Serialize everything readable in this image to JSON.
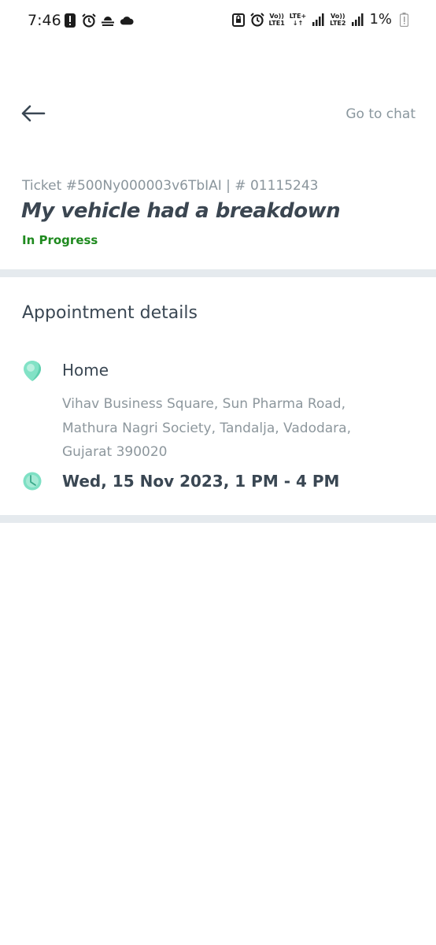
{
  "status_bar": {
    "time": "7:46",
    "left_icons": [
      "alert-icon",
      "alarm-icon",
      "haze-icon",
      "cloud-icon"
    ],
    "right_icons": [
      "sim-lock-icon",
      "alarm-icon",
      "volte-lte1-icon",
      "lte-plus-icon",
      "signal-icon",
      "volte-lte2-icon",
      "signal-icon"
    ],
    "lte1_top": "Vo))",
    "lte1_bottom": "LTE1",
    "lte_plus_top": "LTE+",
    "lte_plus_bottom": "↓↑",
    "lte2_top": "Vo))",
    "lte2_bottom": "LTE2",
    "battery": "1%"
  },
  "header": {
    "go_to_chat": "Go to chat"
  },
  "ticket": {
    "id_line": "Ticket #500Ny000003v6TbIAI | # 01115243",
    "title": "My vehicle had a breakdown",
    "status": "In Progress",
    "status_color": "#1f8a1f"
  },
  "appointment": {
    "section_title": "Appointment details",
    "location_label": "Home",
    "address": "Vihav Business Square, Sun Pharma Road, Mathura Nagri Society, Tandalja, Vadodara, Gujarat 390020",
    "time_slot": "Wed, 15 Nov 2023, 1 PM - 4 PM",
    "accent_color": "#7ee0c4"
  }
}
